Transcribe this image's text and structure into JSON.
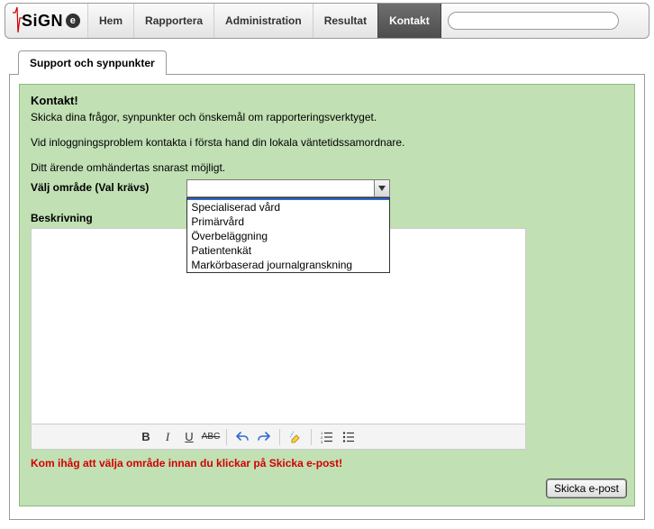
{
  "brand": {
    "name": "SiGN",
    "suffix": "e"
  },
  "nav": {
    "items": [
      {
        "label": "Hem",
        "active": false
      },
      {
        "label": "Rapportera",
        "active": false
      },
      {
        "label": "Administration",
        "active": false
      },
      {
        "label": "Resultat",
        "active": false
      },
      {
        "label": "Kontakt",
        "active": true
      }
    ]
  },
  "search": {
    "placeholder": ""
  },
  "section_tab": "Support och synpunkter",
  "contact": {
    "heading": "Kontakt!",
    "line1": "Skicka dina frågor, synpunkter och önskemål om rapporteringsverktyget.",
    "line2": "Vid inloggningsproblem kontakta i första hand din lokala väntetidssamordnare.",
    "line3": "Ditt ärende omhändertas snarast möjligt."
  },
  "form": {
    "area_label": "Välj område (Val krävs)",
    "area_selected": "",
    "area_options": [
      "",
      "Specialiserad vård",
      "Primärvård",
      "Överbeläggning",
      "Patientenkät",
      "Markörbaserad journalgranskning"
    ],
    "description_label": "Beskrivning",
    "description_value": ""
  },
  "toolbar": {
    "bold": "B",
    "italic": "I",
    "underline": "U",
    "strike": "ABC"
  },
  "reminder": "Kom ihåg att välja område innan du klickar på Skicka e-post!",
  "send_label": "Skicka e-post"
}
